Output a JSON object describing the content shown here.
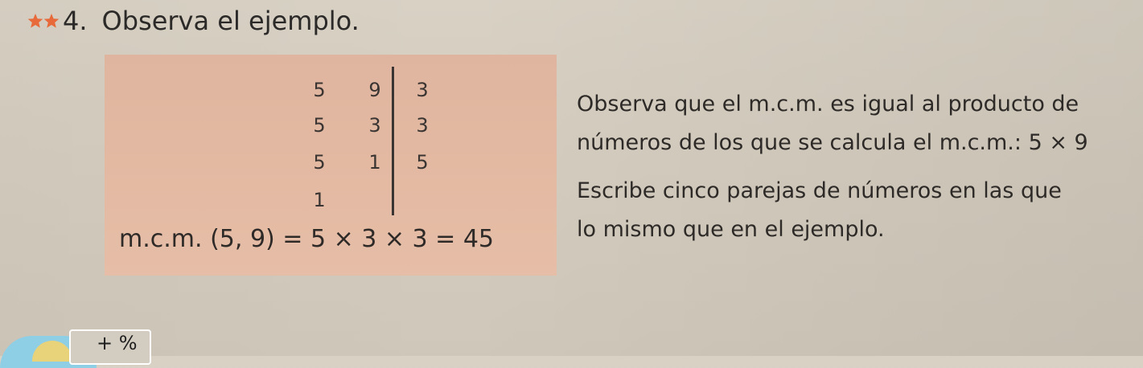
{
  "header": {
    "number": "4.",
    "instruction": "Observa el ejemplo.",
    "difficulty_icons": [
      "star-icon",
      "star-icon"
    ],
    "star_color": "#e86a3a"
  },
  "example": {
    "background_color": "#e3b7a0",
    "rows": [
      {
        "a": "5",
        "b": "9",
        "divisor": "3"
      },
      {
        "a": "5",
        "b": "3",
        "divisor": "3"
      },
      {
        "a": "5",
        "b": "1",
        "divisor": "5"
      },
      {
        "a": "1",
        "b": "",
        "divisor": ""
      }
    ],
    "lcm_text": "m.c.m. (5, 9) = 5 × 3 × 3 = 45"
  },
  "text_lines": [
    "Observa que el m.c.m. es igual al producto de",
    "números de los que se calcula el m.c.m.: 5 × 9",
    "Escribe cinco parejas de números en las que",
    "lo mismo que en el ejemplo."
  ],
  "calc_badge": {
    "symbols": "+ %"
  }
}
